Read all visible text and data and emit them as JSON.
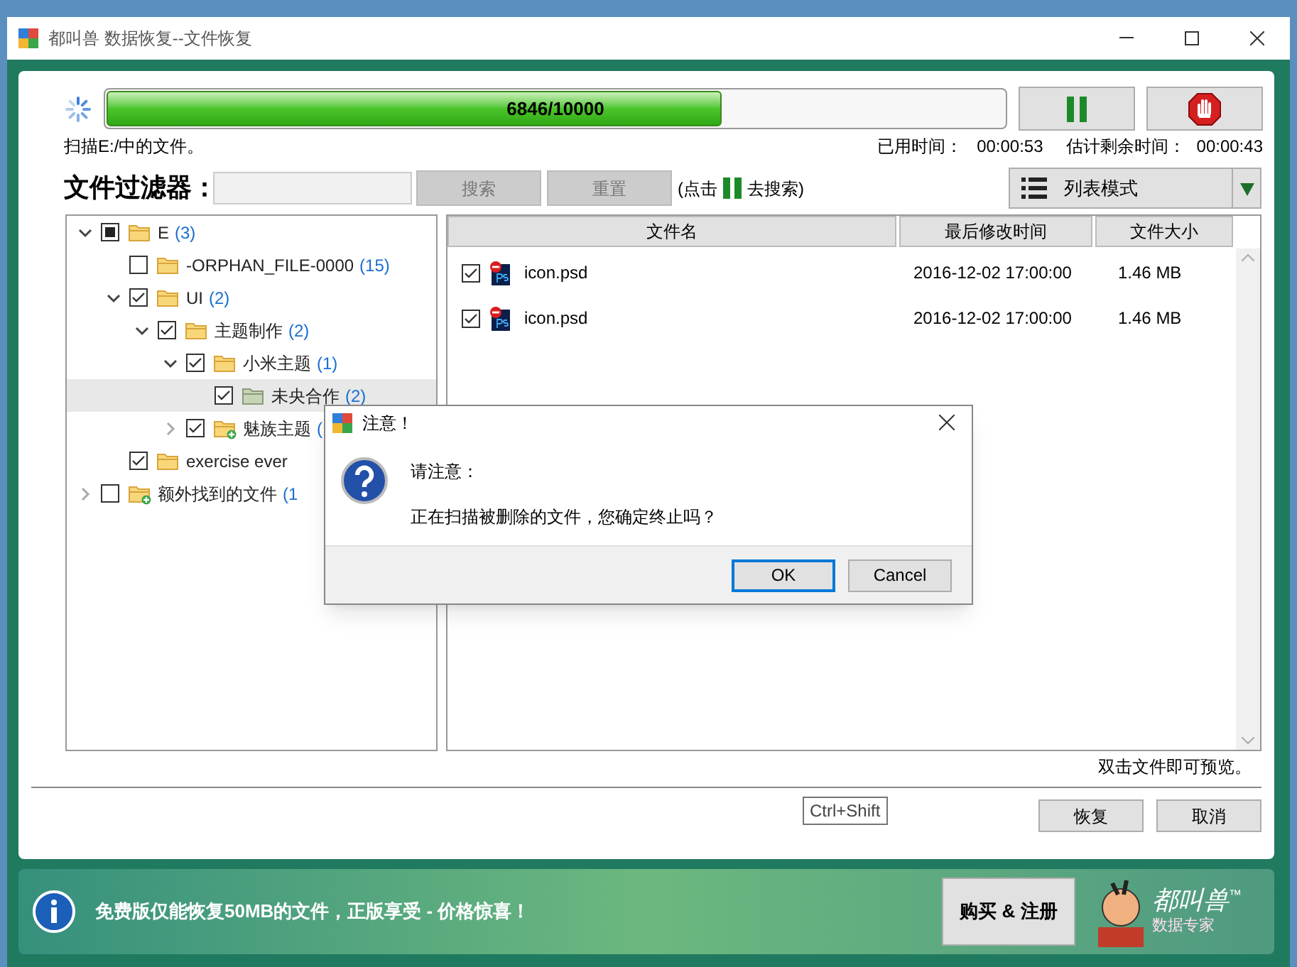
{
  "window": {
    "title": "都叫兽 数据恢复--文件恢复"
  },
  "progress": {
    "level": 0.6846,
    "text": "6846/10000"
  },
  "status": {
    "scanning": "扫描E:/中的文件。",
    "elapsed_label": "已用时间：",
    "elapsed": "00:00:53",
    "remaining_label": "估计剩余时间：",
    "remaining": "00:00:43"
  },
  "filter": {
    "label": "文件过滤器：",
    "search_button": "搜索",
    "reset_button": "重置",
    "hint_before": "(点击",
    "hint_after": "去搜索)",
    "view_mode": "列表模式"
  },
  "tree": [
    {
      "name": "E",
      "count": "(3)",
      "kind": "folder",
      "checked": false,
      "partial": true,
      "expanded": true,
      "selected": false,
      "children": [
        {
          "name": "-ORPHAN_FILE-0000",
          "count": "(15)",
          "kind": "folder",
          "checked": false,
          "partial": false,
          "selected": false
        },
        {
          "name": "UI",
          "count": "(2)",
          "kind": "folder",
          "checked": true,
          "partial": false,
          "expanded": true,
          "selected": false,
          "children": [
            {
              "name": "主题制作",
              "count": "(2)",
              "kind": "folder",
              "checked": true,
              "partial": false,
              "expanded": true,
              "selected": false,
              "children": [
                {
                  "name": "小米主题",
                  "count": "(1)",
                  "kind": "folder",
                  "checked": true,
                  "partial": false,
                  "expanded": true,
                  "selected": false,
                  "children": [
                    {
                      "name": "未央合作",
                      "count": "(2)",
                      "kind": "folder",
                      "checked": true,
                      "partial": false,
                      "selected": true
                    }
                  ]
                },
                {
                  "name": "魅族主题",
                  "count": "(",
                  "kind": "found",
                  "checked": true,
                  "partial": false,
                  "expanded": false,
                  "selected": false
                }
              ]
            }
          ]
        },
        {
          "name": "exercise ever",
          "kind": "folder",
          "checked": true,
          "partial": false,
          "selected": false
        }
      ]
    },
    {
      "name": "额外找到的文件",
      "count": "(1",
      "kind": "found",
      "checked": false,
      "partial": false,
      "expanded": false,
      "selected": false
    }
  ],
  "table": {
    "columns": [
      "文件名",
      "最后修改时间",
      "文件大小"
    ],
    "rows": [
      {
        "checked": true,
        "name": "icon.psd",
        "modified": "2016-12-02 17:00:00",
        "size": "1.46 MB"
      },
      {
        "checked": true,
        "name": "icon.psd",
        "modified": "2016-12-02 17:00:00",
        "size": "1.46 MB"
      }
    ]
  },
  "preview_hint": "双击文件即可预览。",
  "tooltip": "Ctrl+Shift",
  "buttons": [
    "恢复",
    "取消"
  ],
  "banner": {
    "text": "免费版仅能恢复50MB的文件，正版享受 - 价格惊喜！",
    "buy_button": "购买 & 注册",
    "logo_title": "都叫兽",
    "logo_subtitle": "数据专家",
    "trademark": "™"
  },
  "dialog": {
    "title": "注意！",
    "heading": "请注意：",
    "message": "正在扫描被删除的文件，您确定终止吗？",
    "buttons": [
      {
        "label": "OK",
        "selected": true
      },
      {
        "label": "Cancel",
        "selected": false
      }
    ]
  }
}
